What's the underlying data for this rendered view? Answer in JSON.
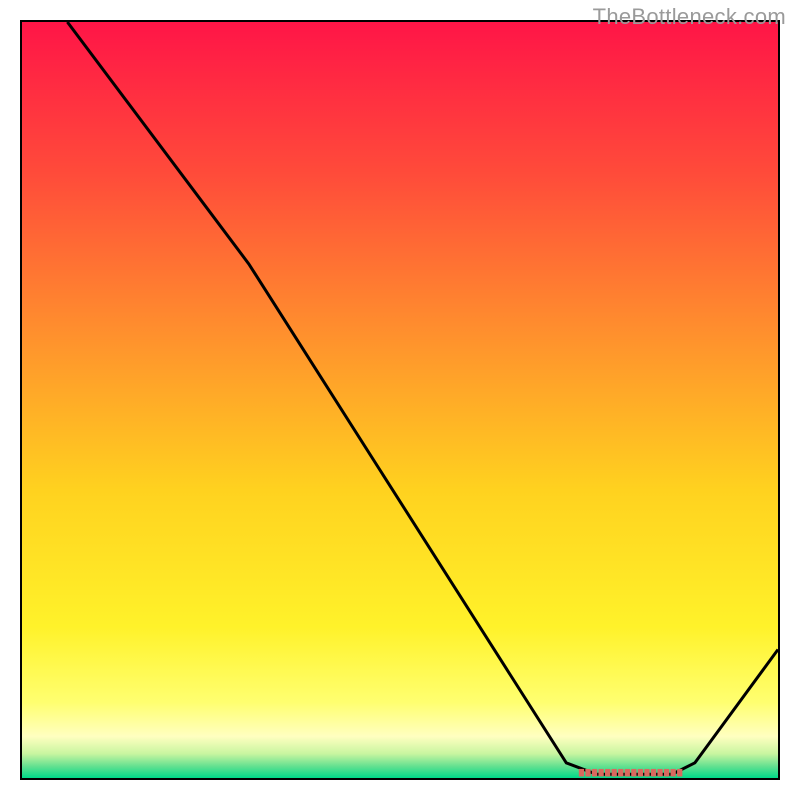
{
  "watermark": "TheBottleneck.com",
  "chart_data": {
    "type": "line",
    "title": "",
    "xlabel": "",
    "ylabel": "",
    "xlim": [
      0,
      100
    ],
    "ylim": [
      0,
      100
    ],
    "gradient_stops": [
      {
        "offset": 0.0,
        "color": "#ff1547"
      },
      {
        "offset": 0.2,
        "color": "#ff4b3a"
      },
      {
        "offset": 0.4,
        "color": "#ff8c2e"
      },
      {
        "offset": 0.62,
        "color": "#ffd21f"
      },
      {
        "offset": 0.8,
        "color": "#fff22a"
      },
      {
        "offset": 0.9,
        "color": "#ffff70"
      },
      {
        "offset": 0.945,
        "color": "#ffffc0"
      },
      {
        "offset": 0.968,
        "color": "#c8f5a0"
      },
      {
        "offset": 0.985,
        "color": "#60e090"
      },
      {
        "offset": 1.0,
        "color": "#00d989"
      }
    ],
    "series": [
      {
        "name": "curve",
        "color": "#000000",
        "points": [
          {
            "x": 6.0,
            "y": 100.0
          },
          {
            "x": 24.0,
            "y": 76.0
          },
          {
            "x": 30.0,
            "y": 68.0
          },
          {
            "x": 72.0,
            "y": 2.0
          },
          {
            "x": 76.0,
            "y": 0.5
          },
          {
            "x": 86.0,
            "y": 0.5
          },
          {
            "x": 89.0,
            "y": 2.0
          },
          {
            "x": 100.0,
            "y": 17.0
          }
        ]
      }
    ],
    "markers": {
      "name": "minimum-band",
      "x_start": 74.0,
      "x_end": 87.0,
      "y": 0.7,
      "color": "#d9695e"
    }
  }
}
